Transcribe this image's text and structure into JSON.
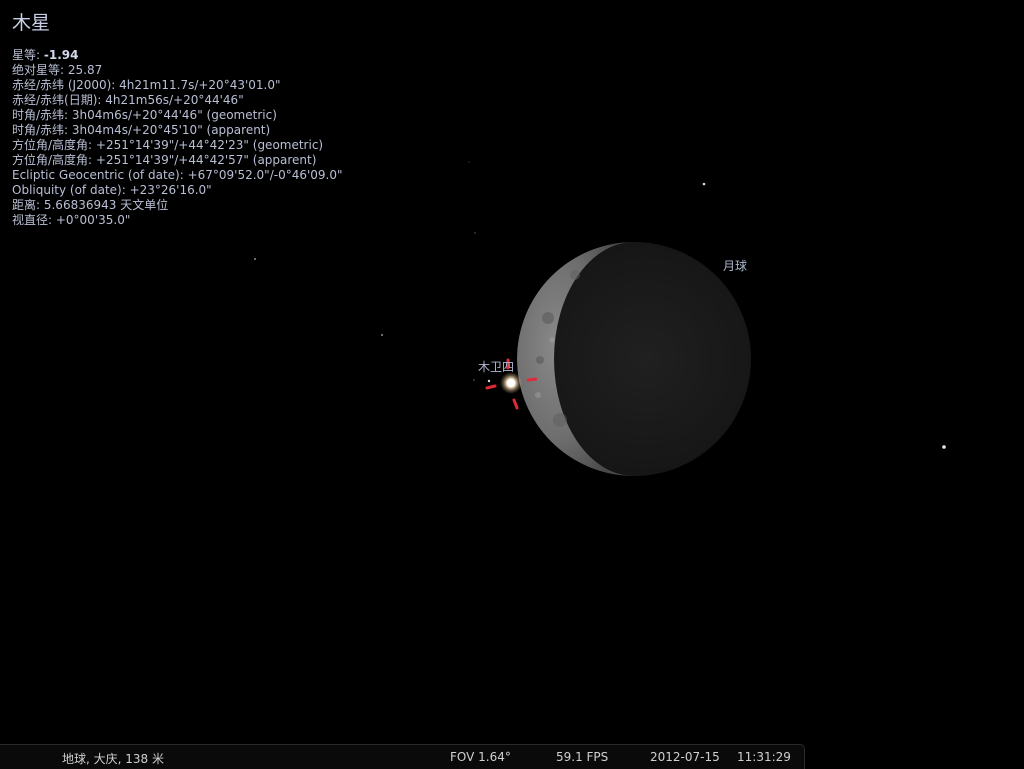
{
  "selected_object": {
    "name": "木星",
    "magnitude_label": "星等:",
    "magnitude_value": "-1.94",
    "info_lines": [
      "绝对星等: 25.87",
      "赤经/赤纬 (J2000): 4h21m11.7s/+20°43'01.0\"",
      "赤经/赤纬(日期): 4h21m56s/+20°44'46\"",
      "时角/赤纬: 3h04m6s/+20°44'46\" (geometric)",
      "时角/赤纬: 3h04m4s/+20°45'10\" (apparent)",
      "方位角/高度角: +251°14'39\"/+44°42'23\" (geometric)",
      "方位角/高度角: +251°14'39\"/+44°42'57\" (apparent)",
      "Ecliptic Geocentric (of date): +67°09'52.0\"/-0°46'09.0\"",
      "Obliquity (of date): +23°26'16.0\"",
      "距离: 5.66836943 天文单位",
      "视直径: +0°00'35.0\""
    ]
  },
  "sky_labels": {
    "moon": "月球",
    "callisto": "木卫四"
  },
  "status_bar": {
    "location": "地球, 大庆, 138 米",
    "fov": "FOV 1.64°",
    "fps": "59.1 FPS",
    "date": "2012-07-15",
    "time": "11:31:29"
  },
  "colors": {
    "background": "#000000",
    "info_text": "#b9bfd4",
    "selection_marker": "#e02a3a"
  }
}
